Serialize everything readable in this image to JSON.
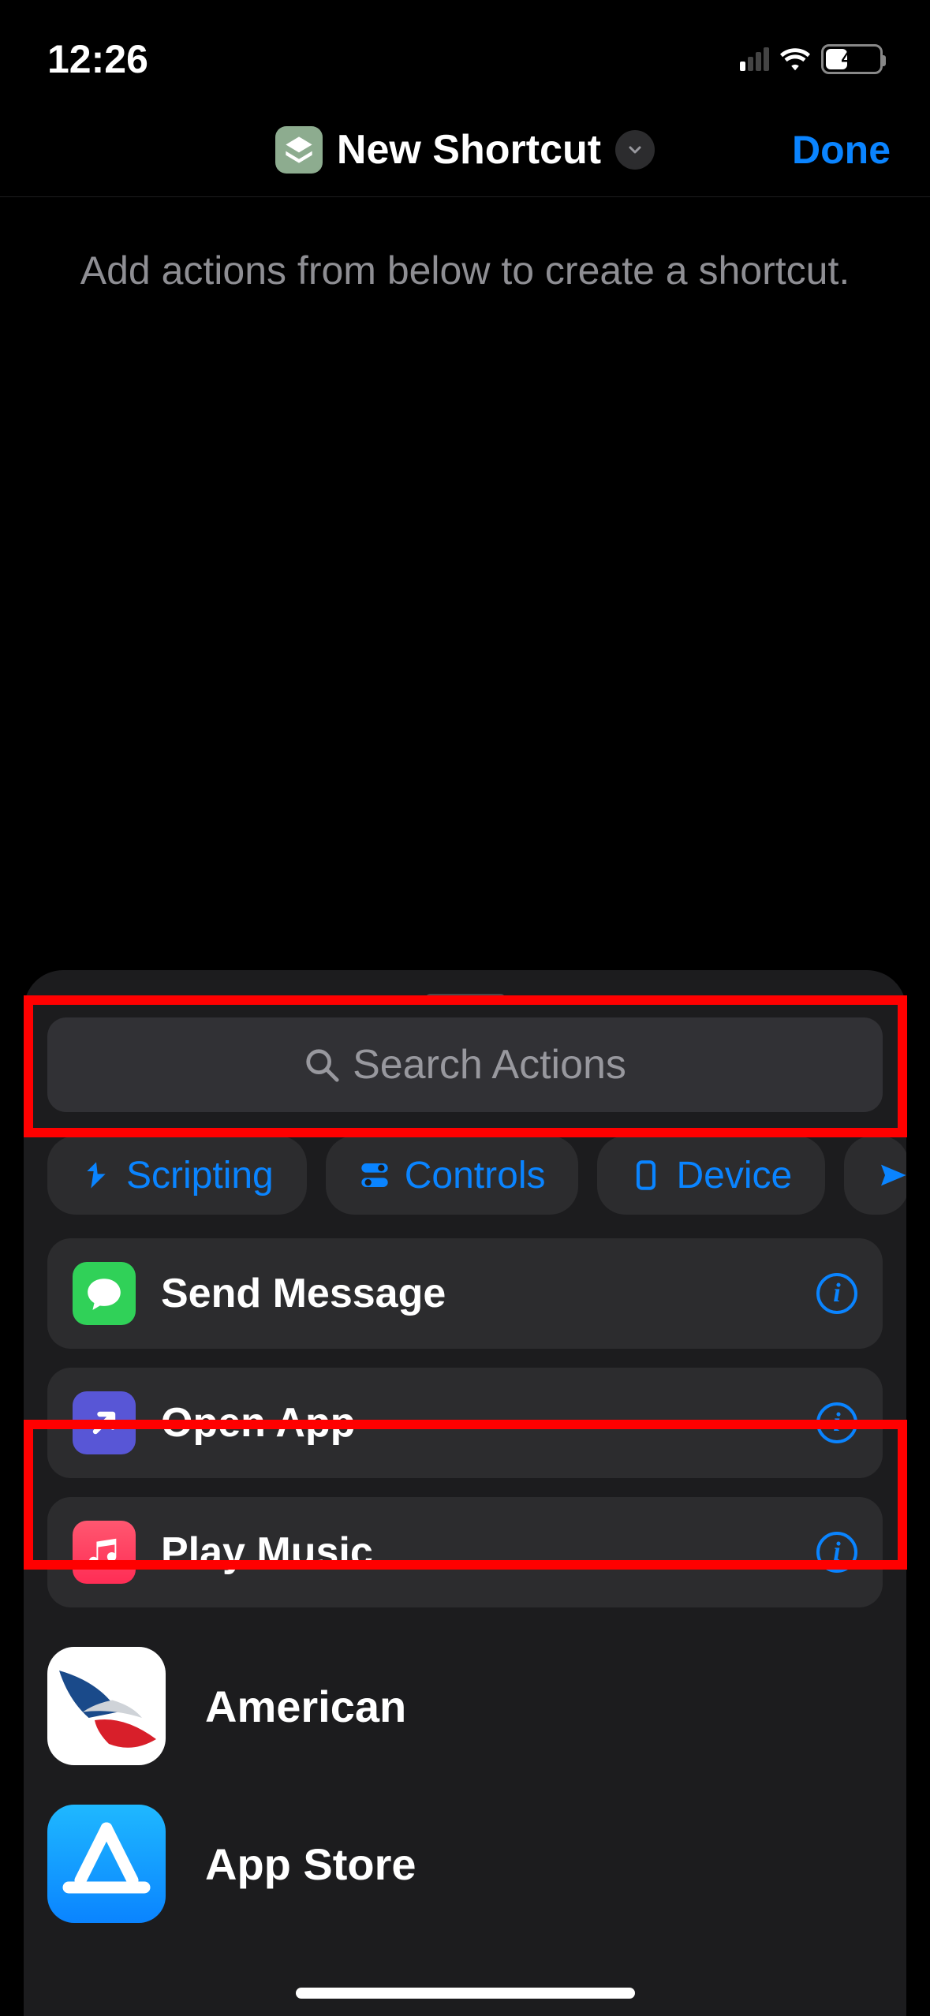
{
  "status": {
    "time": "12:26",
    "battery": "41"
  },
  "nav": {
    "title": "New Shortcut",
    "done": "Done"
  },
  "hint": "Add actions from below to create a shortcut.",
  "search": {
    "placeholder": "Search Actions"
  },
  "chips": [
    {
      "label": "Scripting",
      "icon": "scripting-icon"
    },
    {
      "label": "Controls",
      "icon": "controls-icon"
    },
    {
      "label": "Device",
      "icon": "device-icon"
    }
  ],
  "suggestions": [
    {
      "label": "Send Message",
      "icon": "messages-icon"
    },
    {
      "label": "Open App",
      "icon": "open-app-icon"
    },
    {
      "label": "Play Music",
      "icon": "music-icon"
    }
  ],
  "apps": [
    {
      "label": "American",
      "icon": "american-icon"
    },
    {
      "label": "App Store",
      "icon": "appstore-icon"
    }
  ]
}
